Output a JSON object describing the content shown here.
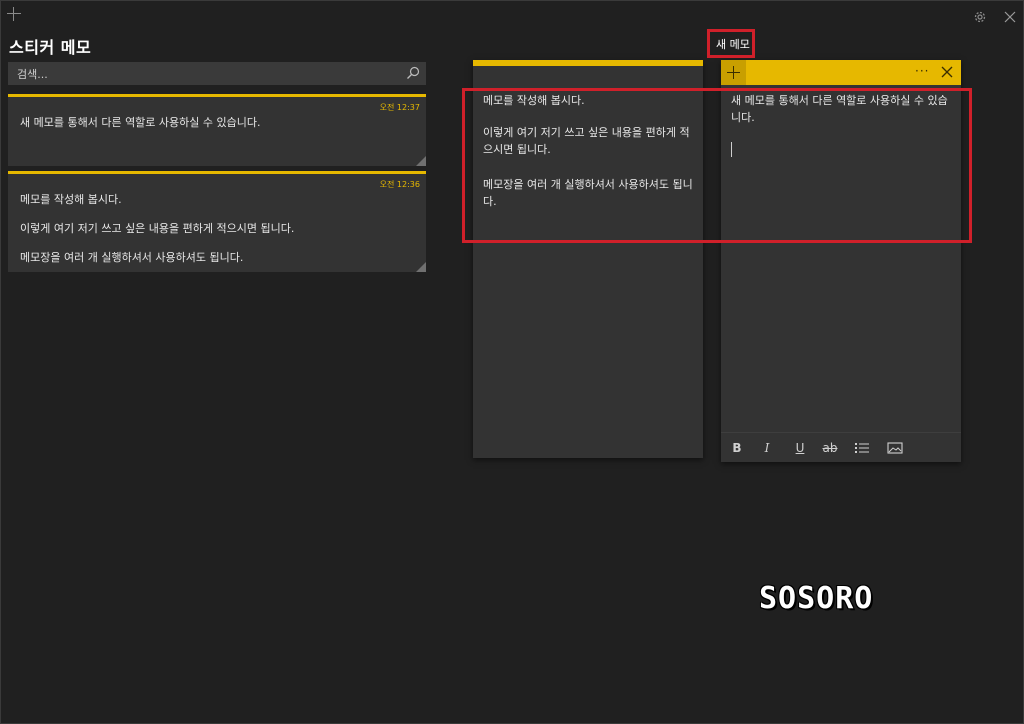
{
  "window": {
    "app_title": "스티커 메모"
  },
  "search": {
    "placeholder": "검색..."
  },
  "list": {
    "cards": [
      {
        "time": "오전 12:37",
        "lines": [
          "새 메모를 통해서 다른 역할로 사용하실 수 있습니다."
        ]
      },
      {
        "time": "오전 12:36",
        "lines": [
          "메모를 작성해 봅시다.",
          "이렇게 여기 저기 쓰고 싶은 내용을 편하게 적으시면 됩니다.",
          "메모장을 여러 개 실행하셔서 사용하셔도 됩니다."
        ]
      }
    ]
  },
  "note_left": {
    "paragraphs": [
      "메모를 작성해 봅시다.",
      "이렇게 여기 저기 쓰고 싶은 내용을 편하게 적으시면 됩니다.",
      "메모장을 여러 개 실행하셔서 사용하셔도 됩니다."
    ]
  },
  "note_right": {
    "more_label": "···",
    "text": "새 메모를 통해서 다른 역할로 사용하실 수 있습니다.",
    "toolbar": {
      "bold": "B",
      "italic": "I",
      "underline": "U",
      "strikethrough": "ab"
    }
  },
  "annotation": {
    "new_memo_label": "새 메모"
  },
  "watermark": "SOSORO",
  "colors": {
    "accent_yellow": "#e6b800",
    "annotation_red": "#d0202a",
    "background": "#202020",
    "card": "#333333"
  },
  "icons": [
    "plus-icon",
    "settings-gear-icon",
    "close-icon",
    "search-icon",
    "more-icon",
    "bulleted-list-icon",
    "image-icon"
  ]
}
